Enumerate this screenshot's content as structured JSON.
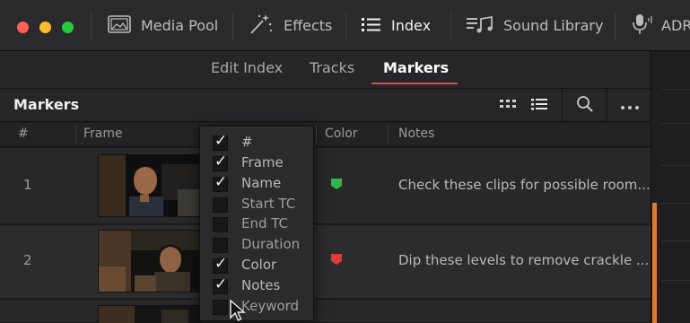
{
  "toolbar": {
    "items": [
      {
        "label": "Media Pool",
        "icon": "media-pool-icon"
      },
      {
        "label": "Effects",
        "icon": "effects-wand-icon"
      },
      {
        "label": "Index",
        "icon": "index-list-icon",
        "active": true
      },
      {
        "label": "Sound Library",
        "icon": "sound-library-icon"
      },
      {
        "label": "ADR",
        "icon": "microphone-icon"
      }
    ]
  },
  "subtabs": [
    {
      "label": "Edit Index"
    },
    {
      "label": "Tracks"
    },
    {
      "label": "Markers",
      "active": true
    }
  ],
  "markers_panel": {
    "title": "Markers",
    "buttons": [
      "grid-view-icon",
      "list-view-icon",
      "search-icon",
      "more-options-icon"
    ]
  },
  "columns": {
    "number": "#",
    "frame": "Frame",
    "color": "Color",
    "notes": "Notes"
  },
  "rows": [
    {
      "number": "1",
      "color": "#2fb64a",
      "notes": "Check these clips for possible room..."
    },
    {
      "number": "2",
      "color": "#e03a36",
      "notes": "Dip these levels to remove crackle ..."
    }
  ],
  "column_menu": {
    "items": [
      {
        "label": "#",
        "checked": true
      },
      {
        "label": "Frame",
        "checked": true
      },
      {
        "label": "Name",
        "checked": true
      },
      {
        "label": "Start TC",
        "checked": false
      },
      {
        "label": "End TC",
        "checked": false
      },
      {
        "label": "Duration",
        "checked": false
      },
      {
        "label": "Color",
        "checked": true
      },
      {
        "label": "Notes",
        "checked": true
      },
      {
        "label": "Keyword",
        "checked": false
      }
    ]
  },
  "colors": {
    "accent_underline": "#e04a4a",
    "side_marker_bar": "#e07a2c"
  }
}
